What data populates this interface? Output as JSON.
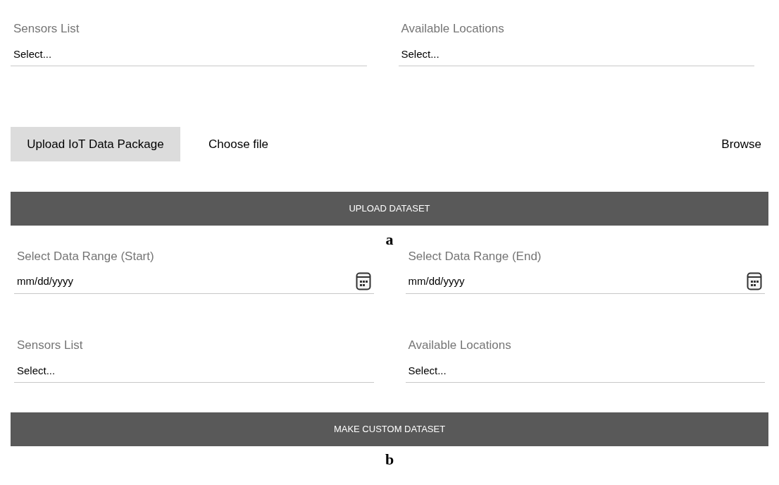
{
  "panel_a": {
    "fields": [
      {
        "label": "Sensors List",
        "value": "Select..."
      },
      {
        "label": "Available Locations",
        "value": "Select..."
      }
    ],
    "upload": {
      "button": "Upload IoT Data Package",
      "file_label": "Choose file",
      "browse": "Browse"
    },
    "submit": "UPLOAD DATASET",
    "caption": "a"
  },
  "panel_b": {
    "date_fields": [
      {
        "label": "Select Data Range (Start)",
        "placeholder": "mm/dd/yyyy"
      },
      {
        "label": "Select Data Range (End)",
        "placeholder": "mm/dd/yyyy"
      }
    ],
    "fields": [
      {
        "label": "Sensors List",
        "value": "Select..."
      },
      {
        "label": "Available Locations",
        "value": "Select..."
      }
    ],
    "submit": "MAKE CUSTOM DATASET",
    "caption": "b"
  }
}
